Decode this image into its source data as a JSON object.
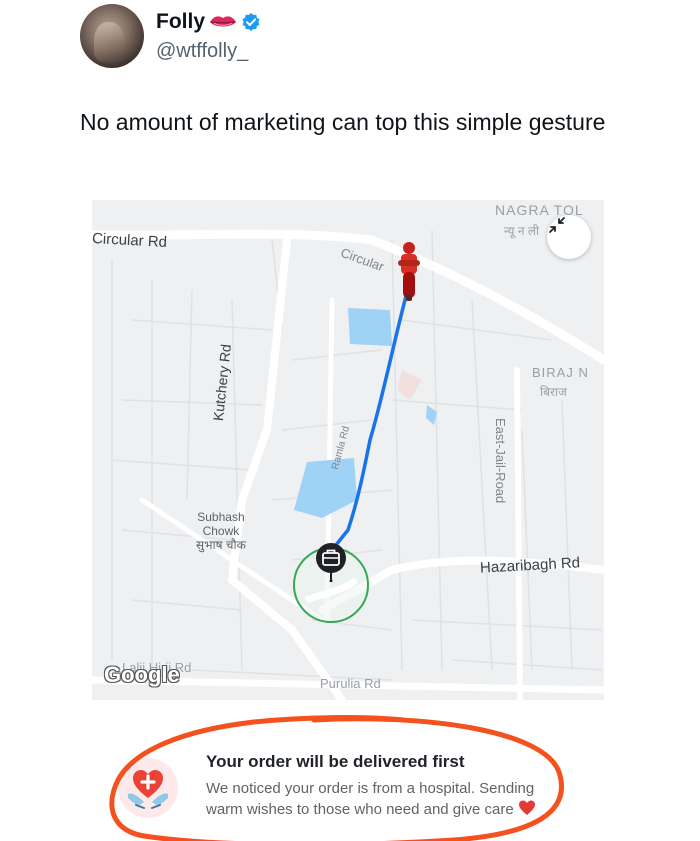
{
  "tweet": {
    "display_name": "Folly",
    "name_emoji": "lips-icon",
    "verified": true,
    "handle": "@wtffolly_",
    "text": "No amount of marketing can top this simple gesture"
  },
  "map": {
    "labels": {
      "circular_rd": "Circular Rd",
      "circular_rd_2": "Circular",
      "kutchery_rd": "Kutchery Rd",
      "east_jail_road": "East-Jail-Road",
      "hazaribagh_rd": "Hazaribagh Rd",
      "subhash_chowk_line1": "Subhash",
      "subhash_chowk_line2": "Chowk",
      "subhash_chowk_hi": "सुभाष चौक",
      "nagra_toli": "NAGRA TOL",
      "nagra_toli_hi": "न्यू न  ली",
      "biraj": "BIRAJ N",
      "biraj_hi": "बिराज",
      "purulia_rd": "Purulia Rd",
      "lalji_hirji_rd": "Lalji Hirji Rd",
      "ramla_rd": "Ramla Rd",
      "google": "Google"
    },
    "colors": {
      "route": "#1a73e8",
      "rider": "#d93025",
      "destination_ring": "#34a853",
      "water": "#9fd3f5"
    },
    "icons": {
      "rider": "delivery-rider-icon",
      "destination": "briefcase-pin-icon",
      "collapse": "collapse-arrows-icon"
    }
  },
  "card": {
    "title": "Your order will be delivered first",
    "body": "We noticed your order is from a hospital. Sending warm wishes to those who need and give care",
    "body_emoji": "red-heart-emoji",
    "icon": "hospital-heart-hands-icon"
  },
  "annotation": {
    "color": "#f4511e",
    "shape": "hand-drawn circle"
  }
}
